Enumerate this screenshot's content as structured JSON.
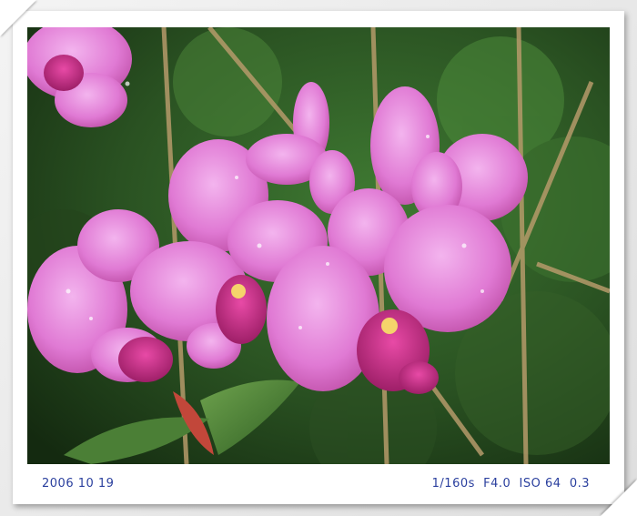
{
  "photo": {
    "subject": "pink-orchid-flowers-icon"
  },
  "caption": {
    "date": "2006 10 19",
    "exif": "1/160s  F4.0  ISO 64  0.3"
  },
  "colors": {
    "caption_text": "#2a3f9e",
    "petal": "#e27fd6",
    "petal_dark": "#c04fae",
    "foliage": "#2f5a25"
  }
}
